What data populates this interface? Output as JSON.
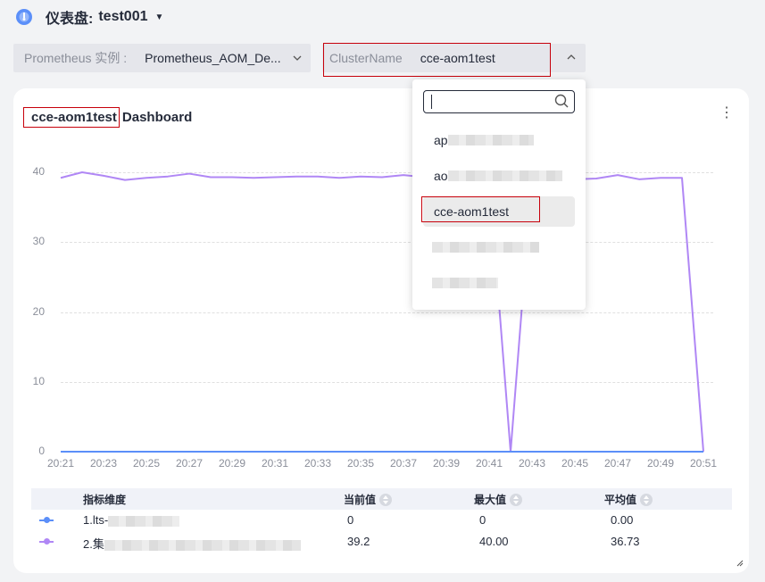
{
  "header": {
    "icon": "dashboard-icon",
    "title_prefix": "仪表盘:",
    "title_name": "test001"
  },
  "filters": {
    "instance": {
      "label": "Prometheus 实例 :",
      "value": "Prometheus_AOM_De..."
    },
    "cluster": {
      "label": "ClusterName",
      "value": "cce-aom1test"
    }
  },
  "panel": {
    "title_highlight": "cce-aom1test",
    "title_rest": "Dashboard"
  },
  "dropdown": {
    "search_value": "",
    "options": [
      {
        "label": "ap",
        "selected": false
      },
      {
        "label": "ao",
        "selected": false
      },
      {
        "label": "cce-aom1test",
        "selected": true
      },
      {
        "label": "",
        "selected": false
      },
      {
        "label": "",
        "selected": false
      }
    ]
  },
  "chart_data": {
    "type": "line",
    "x": [
      "20:21",
      "20:22",
      "20:23",
      "20:24",
      "20:25",
      "20:26",
      "20:27",
      "20:28",
      "20:29",
      "20:30",
      "20:31",
      "20:32",
      "20:33",
      "20:34",
      "20:35",
      "20:36",
      "20:37",
      "20:38",
      "20:39",
      "20:40",
      "20:41",
      "20:42",
      "20:43",
      "20:44",
      "20:45",
      "20:46",
      "20:47",
      "20:48",
      "20:49",
      "20:50",
      "20:51"
    ],
    "xticks": [
      "20:21",
      "20:23",
      "20:25",
      "20:27",
      "20:29",
      "20:31",
      "20:33",
      "20:35",
      "20:37",
      "20:39",
      "20:41",
      "20:43",
      "20:45",
      "20:47",
      "20:49",
      "20:51"
    ],
    "yticks": [
      0,
      10,
      20,
      30,
      40
    ],
    "ylim": [
      0,
      42
    ],
    "grid": true,
    "series": [
      {
        "color": "#5b8ff9",
        "values": [
          0,
          0,
          0,
          0,
          0,
          0,
          0,
          0,
          0,
          0,
          0,
          0,
          0,
          0,
          0,
          0,
          0,
          0,
          0,
          0,
          0,
          0,
          0,
          0,
          0,
          0,
          0,
          0,
          0,
          0,
          0
        ]
      },
      {
        "color": "#b087f5",
        "values": [
          39.2,
          40.0,
          39.5,
          38.9,
          39.2,
          39.4,
          39.8,
          39.3,
          39.3,
          39.2,
          39.3,
          39.4,
          39.4,
          39.2,
          39.4,
          39.3,
          39.6,
          39.3,
          39.3,
          39.4,
          39.2,
          0,
          39.2,
          39.0,
          39.0,
          39.1,
          39.6,
          39.0,
          39.2,
          39.2,
          0
        ]
      }
    ]
  },
  "table": {
    "headers": {
      "dim": "指标维度",
      "current": "当前值",
      "max": "最大值",
      "avg": "平均值"
    },
    "rows": [
      {
        "name": "1.lts-",
        "current": "0",
        "max": "0",
        "avg": "0.00",
        "color": "#5b8ff9"
      },
      {
        "name": "2.集",
        "current": "39.2",
        "max": "40.00",
        "avg": "36.73",
        "color": "#b087f5"
      }
    ]
  }
}
